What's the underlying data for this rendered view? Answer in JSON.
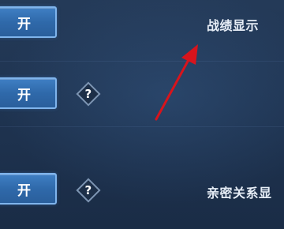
{
  "settings": [
    {
      "toggle_label": "开",
      "label": "战绩显示",
      "has_help": false
    },
    {
      "toggle_label": "开",
      "label": "",
      "has_help": true
    },
    {
      "toggle_label": "开",
      "label": "亲密关系显",
      "has_help": true
    }
  ],
  "help": {
    "glyph": "?"
  },
  "colors": {
    "background": "#1f3451",
    "button_fill": "#2f69aa",
    "button_border": "#7fb4ec",
    "annotation_arrow": "#d8141c"
  },
  "icons": {
    "help": "question-diamond-icon",
    "annotation": "red-arrow-icon"
  }
}
